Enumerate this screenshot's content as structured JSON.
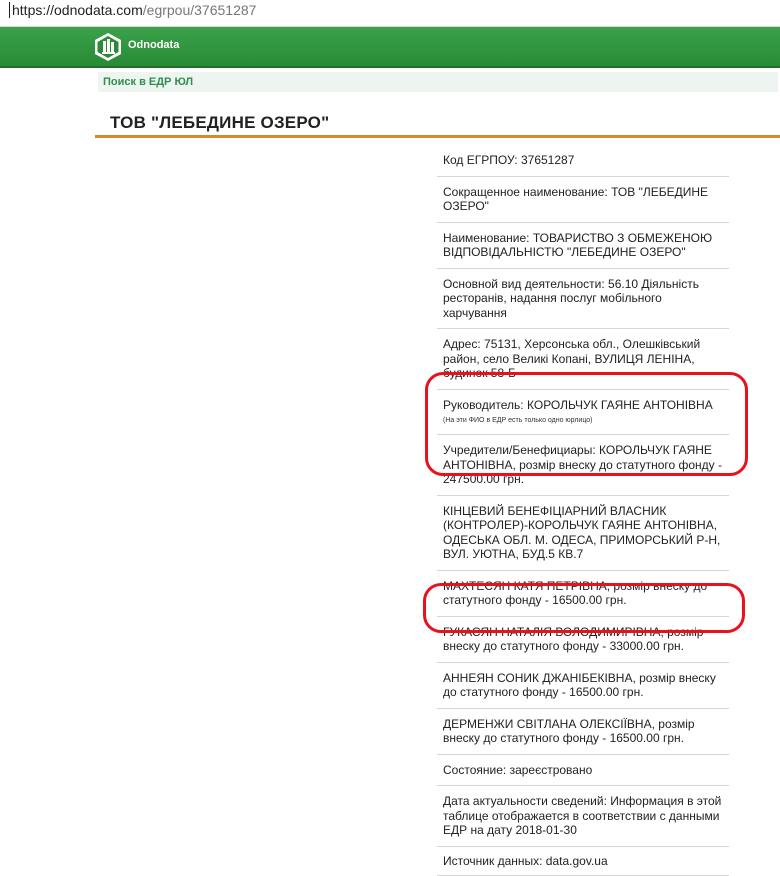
{
  "browser": {
    "url_host": "https://odnodata.com",
    "url_path": "/egrpou/37651287"
  },
  "header": {
    "brand": "Odnodata",
    "logo_icon": "hexagon-building-logo",
    "accent_color": "#2f9a40"
  },
  "subnav": {
    "link_label": "Поиск в ЕДР ЮЛ"
  },
  "page": {
    "title": "ТОВ \"ЛЕБЕДИНЕ ОЗЕРО\""
  },
  "details": [
    {
      "label": "Код ЕГРПОУ:",
      "value": "37651287"
    },
    {
      "label": "Сокращенное наименование:",
      "value": "ТОВ \"ЛЕБЕДИНЕ ОЗЕРО\""
    },
    {
      "label": "Наименование:",
      "value": "ТОВАРИСТВО З ОБМЕЖЕНОЮ ВІДПОВІДАЛЬНІСТЮ \"ЛЕБЕДИНЕ ОЗЕРО\""
    },
    {
      "label": "Основной вид деятельности:",
      "value": "56.10 Діяльність ресторанів, надання послуг мобільного харчування"
    },
    {
      "label": "Адрес:",
      "value": "75131, Херсонська обл., Олешківський район, село Великі Копані, ВУЛИЦЯ ЛЕНІНА, будинок 58-Б"
    },
    {
      "label": "Руководитель:",
      "value": "КОРОЛЬЧУК ГАЯНЕ АНТОНІВНА",
      "note": "(На эти ФИО в ЕДР есть только одно юрлицо)"
    },
    {
      "label": "Учредители/Бенефициары:",
      "value": "КОРОЛЬЧУК ГАЯНЕ АНТОНІВНА, розмір внеску до статутного фонду - 247500.00 грн."
    },
    {
      "text": "КІНЦЕВИЙ БЕНЕФІЦІАРНИЙ ВЛАСНИК (КОНТРОЛЕР)-КОРОЛЬЧУК ГАЯНЕ АНТОНІВНА, ОДЕСЬКА ОБЛ. М. ОДЕСА, ПРИМОРСЬКИЙ Р-Н, ВУЛ. УЮТНА, БУД.5 КВ.7"
    },
    {
      "text": "МАХТЕСЯН КАТЯ ПЕТРІВНА, розмір внеску до статутного фонду - 16500.00 грн."
    },
    {
      "text": "ГУКАСЯН НАТАЛІЯ ВОЛОДИМИРІВНА, розмір внеску до статутного фонду - 33000.00 грн."
    },
    {
      "text": "АННЕЯН СОНИК ДЖАНІБЕКІВНА, розмір внеску до статутного фонду - 16500.00 грн."
    },
    {
      "text": "ДЕРМЕНЖИ СВІТЛАНА ОЛЕКСІЇВНА, розмір внеску до статутного фонду - 16500.00 грн."
    },
    {
      "label": "Состояние:",
      "value": "зареєстровано"
    },
    {
      "label": "Дата актуальности сведений:",
      "value": "Информация в этой таблице отображается в соответствии с данными ЕДР на дату 2018-01-30"
    },
    {
      "label": "Источник данных:",
      "value": "data.gov.ua"
    }
  ],
  "annotations": {
    "highlight_color": "#e8121a"
  }
}
